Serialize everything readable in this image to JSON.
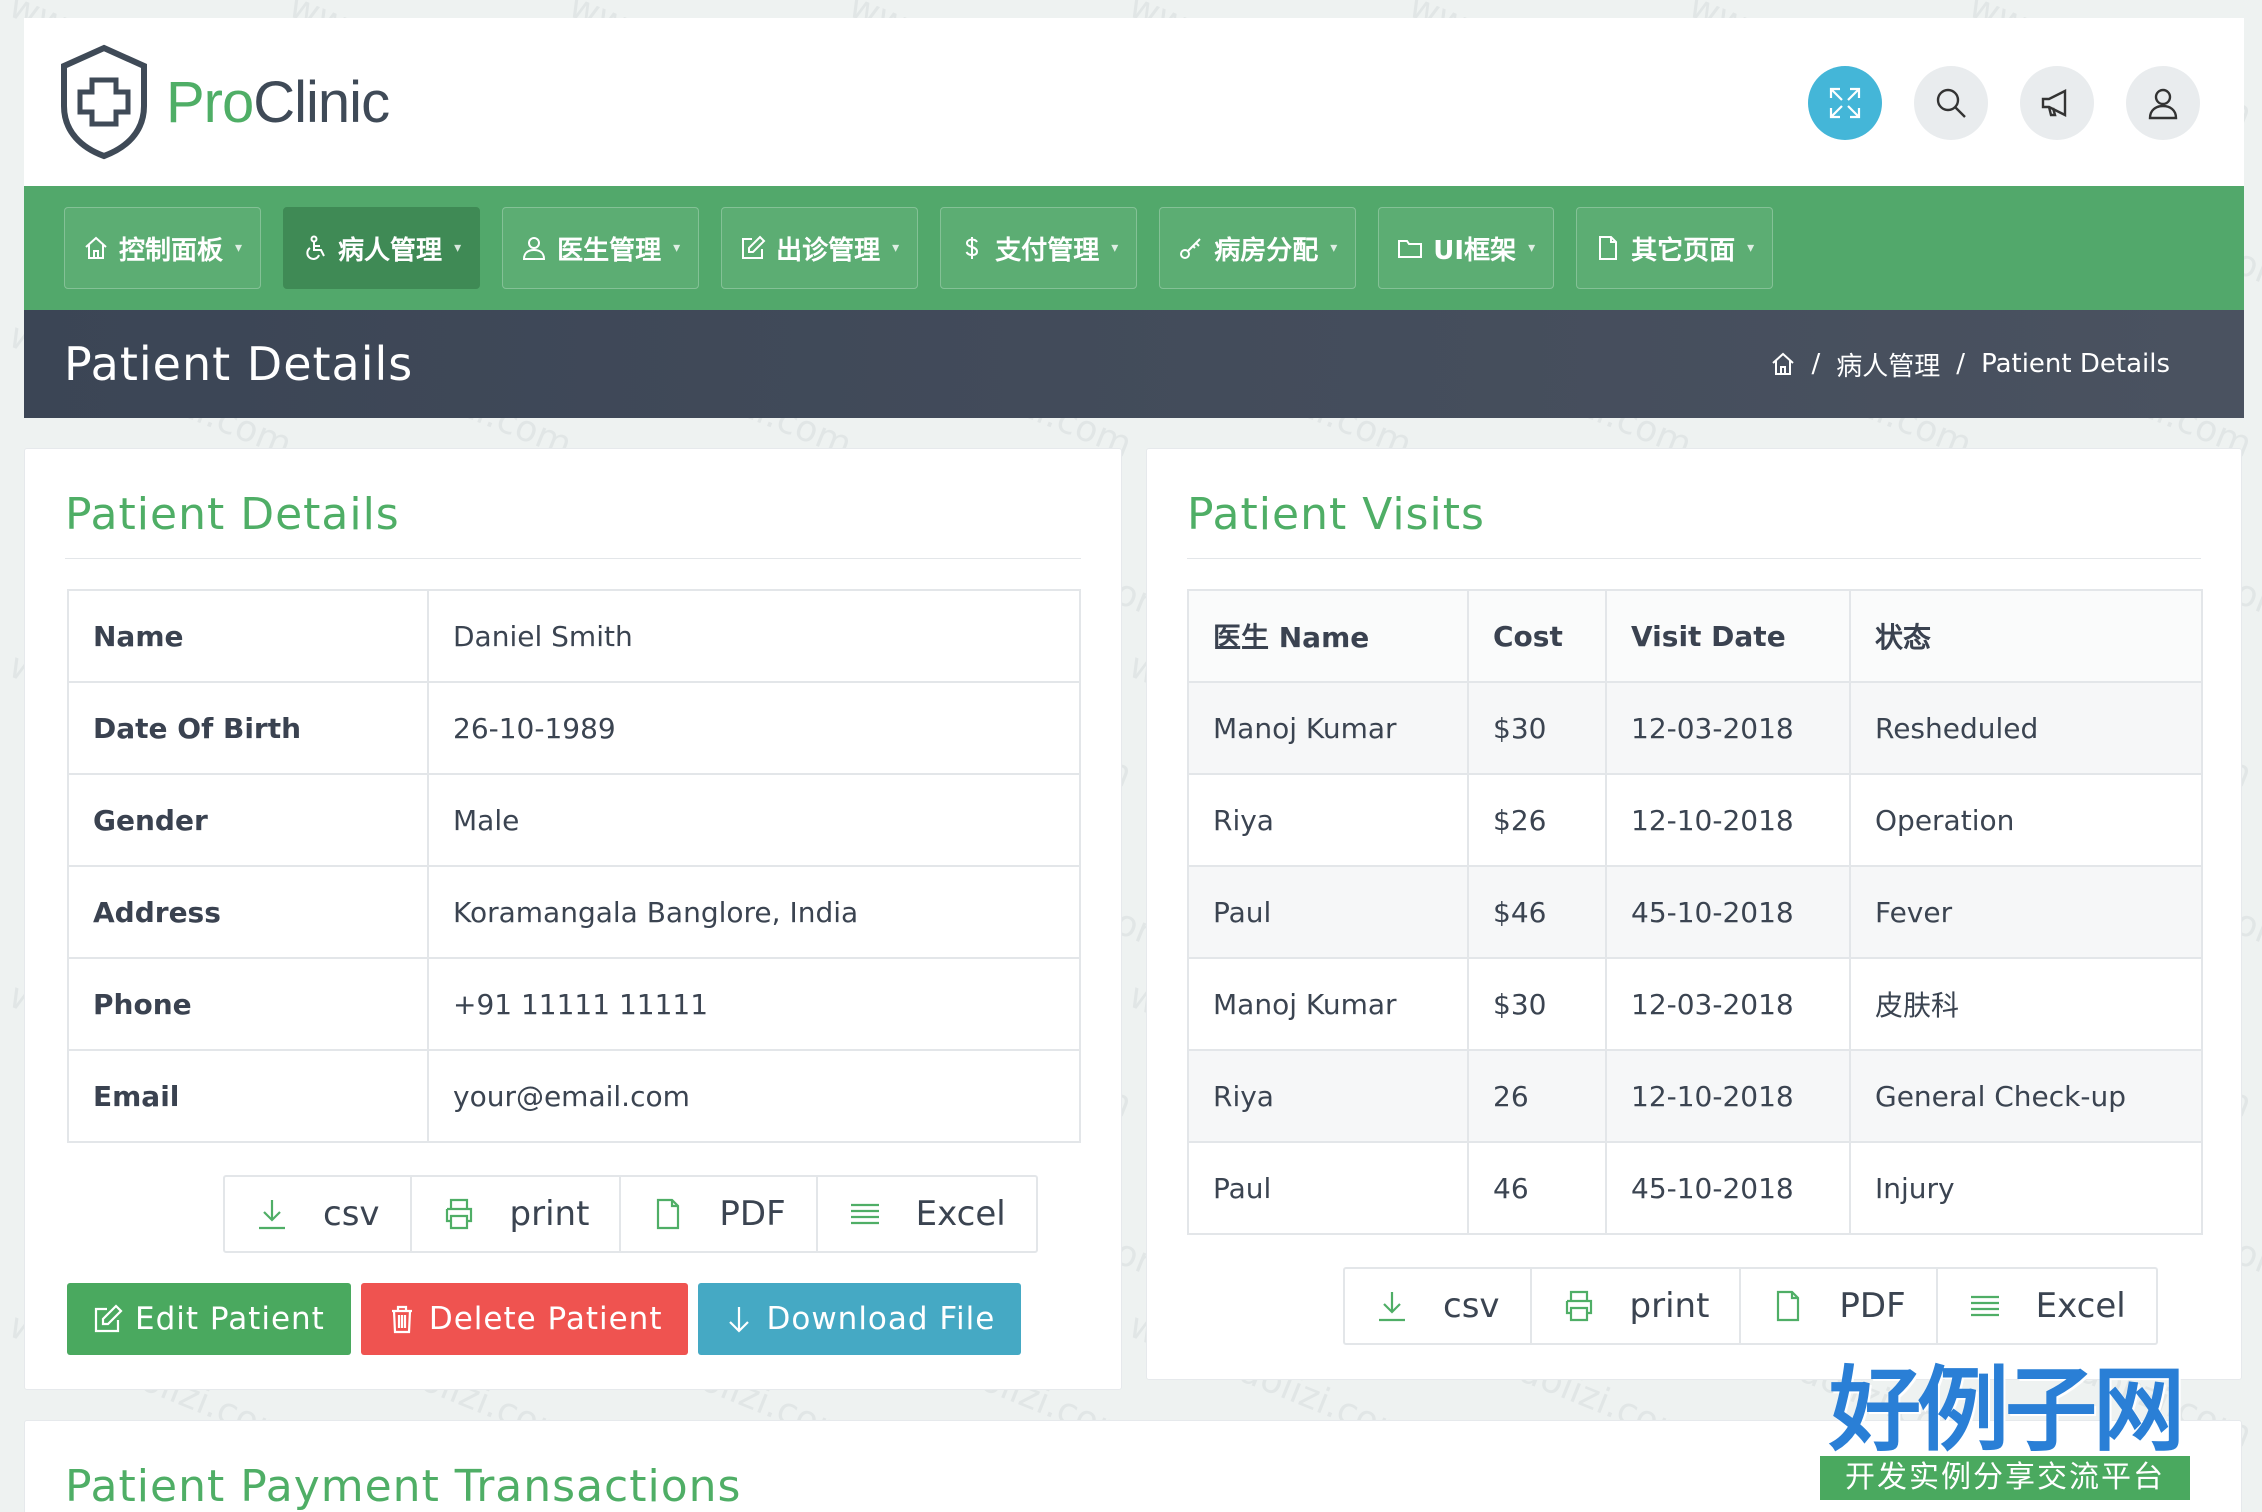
{
  "brand": {
    "pro": "Pro",
    "clinic": "Clinic"
  },
  "top_icons": [
    "fullscreen-icon",
    "search-icon",
    "megaphone-icon",
    "user-icon"
  ],
  "nav": [
    {
      "label": "控制面板",
      "icon": "home-icon"
    },
    {
      "label": "病人管理",
      "icon": "accessibility-icon",
      "active": true
    },
    {
      "label": "医生管理",
      "icon": "doctor-icon"
    },
    {
      "label": "出诊管理",
      "icon": "edit-icon"
    },
    {
      "label": "支付管理",
      "icon": "dollar-icon"
    },
    {
      "label": "病房分配",
      "icon": "key-icon"
    },
    {
      "label": "UI框架",
      "icon": "folder-icon"
    },
    {
      "label": "其它页面",
      "icon": "file-icon"
    }
  ],
  "page_title": "Patient Details",
  "breadcrumb": {
    "section": "病人管理",
    "current": "Patient Details",
    "separator": "/"
  },
  "patient_details": {
    "title": "Patient Details",
    "rows": [
      {
        "key": "Name",
        "value": "Daniel Smith"
      },
      {
        "key": "Date Of Birth",
        "value": "26-10-1989"
      },
      {
        "key": "Gender",
        "value": "Male"
      },
      {
        "key": "Address",
        "value": "Koramangala Banglore, India"
      },
      {
        "key": "Phone",
        "value": "+91 11111 11111"
      },
      {
        "key": "Email",
        "value": "your@email.com"
      }
    ]
  },
  "export": {
    "csv": "csv",
    "print": "print",
    "pdf": "PDF",
    "excel": "Excel"
  },
  "actions": {
    "edit": "Edit Patient",
    "delete": "Delete Patient",
    "download": "Download File"
  },
  "visits": {
    "title": "Patient Visits",
    "headers": [
      "医生 Name",
      "Cost",
      "Visit Date",
      "状态"
    ],
    "rows": [
      [
        "Manoj Kumar",
        "$30",
        "12-03-2018",
        "Resheduled"
      ],
      [
        "Riya",
        "$26",
        "12-10-2018",
        "Operation"
      ],
      [
        "Paul",
        "$46",
        "45-10-2018",
        "Fever"
      ],
      [
        "Manoj Kumar",
        "$30",
        "12-03-2018",
        "皮肤科"
      ],
      [
        "Riya",
        "26",
        "12-10-2018",
        "General Check-up"
      ],
      [
        "Paul",
        "46",
        "45-10-2018",
        "Injury"
      ]
    ]
  },
  "payments_title": "Patient Payment Transactions",
  "badge": {
    "big": "好例子网",
    "small": "开发实例分享交流平台"
  },
  "watermark": "www.haolizi.com",
  "colors": {
    "green": "#52a86b",
    "accent_green": "#4fae66",
    "cyan": "#44b6d8",
    "red": "#ef5350",
    "dark": "#3b4555"
  }
}
